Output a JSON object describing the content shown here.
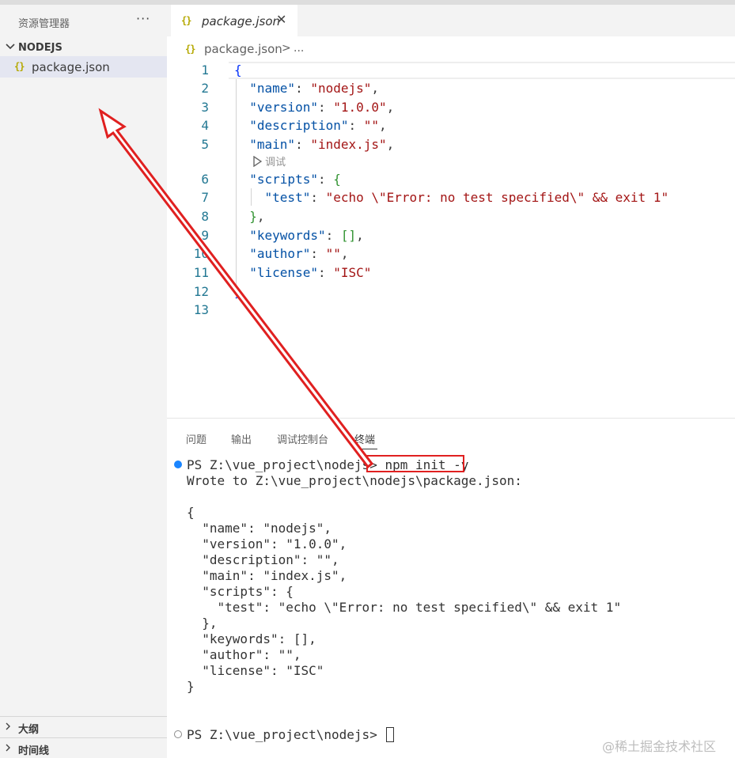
{
  "sidebar": {
    "title": "资源管理器",
    "more": "···",
    "folder": "NODEJS",
    "file": "package.json",
    "file_icon": "{}",
    "sections": [
      {
        "label": "大纲"
      },
      {
        "label": "时间线"
      }
    ]
  },
  "editor": {
    "tab": {
      "icon": "{}",
      "title": "package.json",
      "close": "✕"
    },
    "breadcrumb": {
      "icon": "{}",
      "file": "package.json",
      "sep": ">",
      "more": "..."
    },
    "codelens": "调试",
    "lines": {
      "1": {
        "n": "1",
        "open": "{"
      },
      "2": {
        "n": "2",
        "key": "\"name\"",
        "colon": ": ",
        "val": "\"nodejs\"",
        "comma": ","
      },
      "3": {
        "n": "3",
        "key": "\"version\"",
        "colon": ": ",
        "val": "\"1.0.0\"",
        "comma": ","
      },
      "4": {
        "n": "4",
        "key": "\"description\"",
        "colon": ": ",
        "val": "\"\"",
        "comma": ","
      },
      "5": {
        "n": "5",
        "key": "\"main\"",
        "colon": ": ",
        "val": "\"index.js\"",
        "comma": ","
      },
      "6": {
        "n": "6",
        "key": "\"scripts\"",
        "colon": ": ",
        "open": "{"
      },
      "7": {
        "n": "7",
        "key": "\"test\"",
        "colon": ": ",
        "val": "\"echo \\\"Error: no test specified\\\" && exit 1\""
      },
      "8": {
        "n": "8",
        "close": "}",
        "comma": ","
      },
      "9": {
        "n": "9",
        "key": "\"keywords\"",
        "colon": ": ",
        "val": "[]",
        "comma": ","
      },
      "10": {
        "n": "10",
        "key": "\"author\"",
        "colon": ": ",
        "val": "\"\"",
        "comma": ","
      },
      "11": {
        "n": "11",
        "key": "\"license\"",
        "colon": ": ",
        "val": "\"ISC\""
      },
      "12": {
        "n": "12",
        "close": "}"
      },
      "13": {
        "n": "13"
      }
    }
  },
  "panel": {
    "tabs": [
      "问题",
      "输出",
      "调试控制台",
      "终端"
    ],
    "terminal": {
      "prompt": "PS Z:\\vue_project\\nodejs>",
      "command": "npm init -y",
      "wrote": "Wrote to Z:\\vue_project\\nodejs\\package.json:",
      "json_lines": [
        "{",
        "  \"name\": \"nodejs\",",
        "  \"version\": \"1.0.0\",",
        "  \"description\": \"\",",
        "  \"main\": \"index.js\",",
        "  \"scripts\": {",
        "    \"test\": \"echo \\\"Error: no test specified\\\" && exit 1\"",
        "  },",
        "  \"keywords\": [],",
        "  \"author\": \"\",",
        "  \"license\": \"ISC\"",
        "}"
      ],
      "prompt2": "PS Z:\\vue_project\\nodejs>"
    }
  },
  "watermark": "@稀土掘金技术社区",
  "colors": {
    "key": "#0451a5",
    "string": "#a31515",
    "line_number": "#237893",
    "annotation_red": "#e02020",
    "terminal_dot": "#1a85ff"
  },
  "icons": [
    "more-icon",
    "chevron-down-icon",
    "chevron-right-icon",
    "json-file-icon",
    "close-icon",
    "play-icon",
    "arrow-annotation"
  ]
}
